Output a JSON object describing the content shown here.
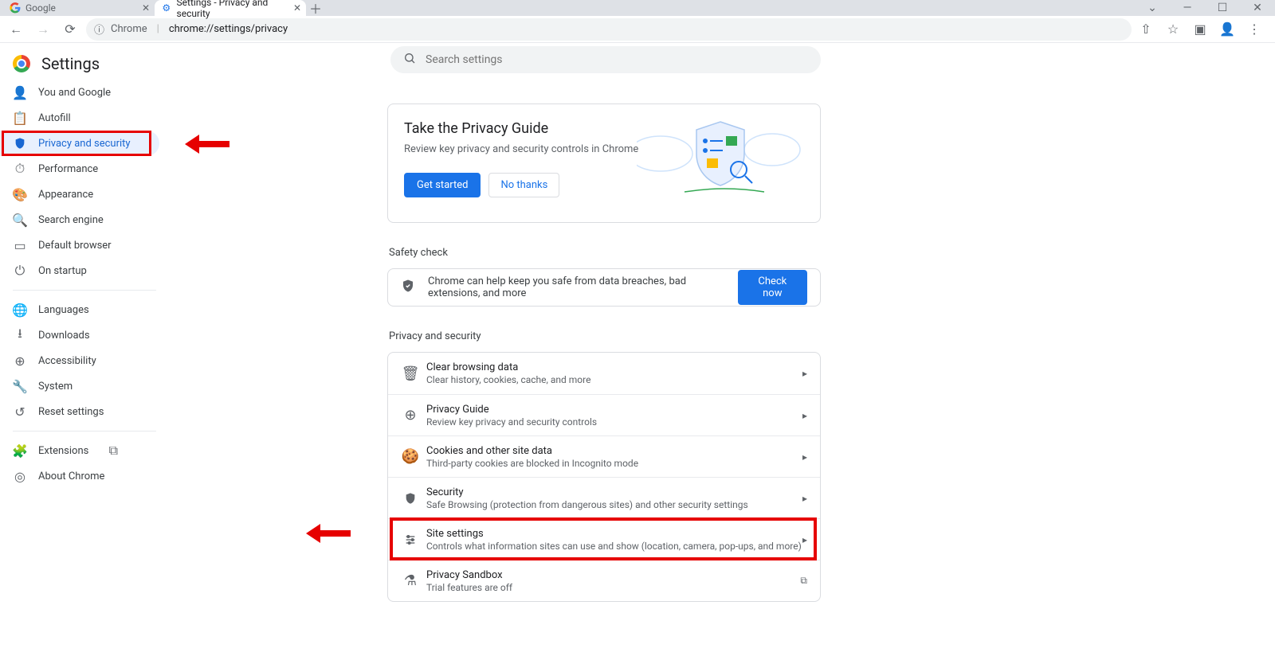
{
  "tabs": [
    {
      "label": "Google"
    },
    {
      "label": "Settings - Privacy and security"
    }
  ],
  "omnibox": {
    "scheme": "Chrome",
    "url": "chrome://settings/privacy"
  },
  "settings_title": "Settings",
  "search_placeholder": "Search settings",
  "sidebar": {
    "items": [
      {
        "label": "You and Google"
      },
      {
        "label": "Autofill"
      },
      {
        "label": "Privacy and security"
      },
      {
        "label": "Performance"
      },
      {
        "label": "Appearance"
      },
      {
        "label": "Search engine"
      },
      {
        "label": "Default browser"
      },
      {
        "label": "On startup"
      }
    ],
    "group2": [
      {
        "label": "Languages"
      },
      {
        "label": "Downloads"
      },
      {
        "label": "Accessibility"
      },
      {
        "label": "System"
      },
      {
        "label": "Reset settings"
      }
    ],
    "group3": [
      {
        "label": "Extensions"
      },
      {
        "label": "About Chrome"
      }
    ]
  },
  "guide": {
    "title": "Take the Privacy Guide",
    "subtitle": "Review key privacy and security controls in Chrome",
    "get_started": "Get started",
    "no_thanks": "No thanks"
  },
  "safety": {
    "heading": "Safety check",
    "text": "Chrome can help keep you safe from data breaches, bad extensions, and more",
    "button": "Check now"
  },
  "privsec": {
    "heading": "Privacy and security",
    "rows": [
      {
        "title": "Clear browsing data",
        "sub": "Clear history, cookies, cache, and more"
      },
      {
        "title": "Privacy Guide",
        "sub": "Review key privacy and security controls"
      },
      {
        "title": "Cookies and other site data",
        "sub": "Third-party cookies are blocked in Incognito mode"
      },
      {
        "title": "Security",
        "sub": "Safe Browsing (protection from dangerous sites) and other security settings"
      },
      {
        "title": "Site settings",
        "sub": "Controls what information sites can use and show (location, camera, pop-ups, and more)"
      },
      {
        "title": "Privacy Sandbox",
        "sub": "Trial features are off"
      }
    ]
  }
}
